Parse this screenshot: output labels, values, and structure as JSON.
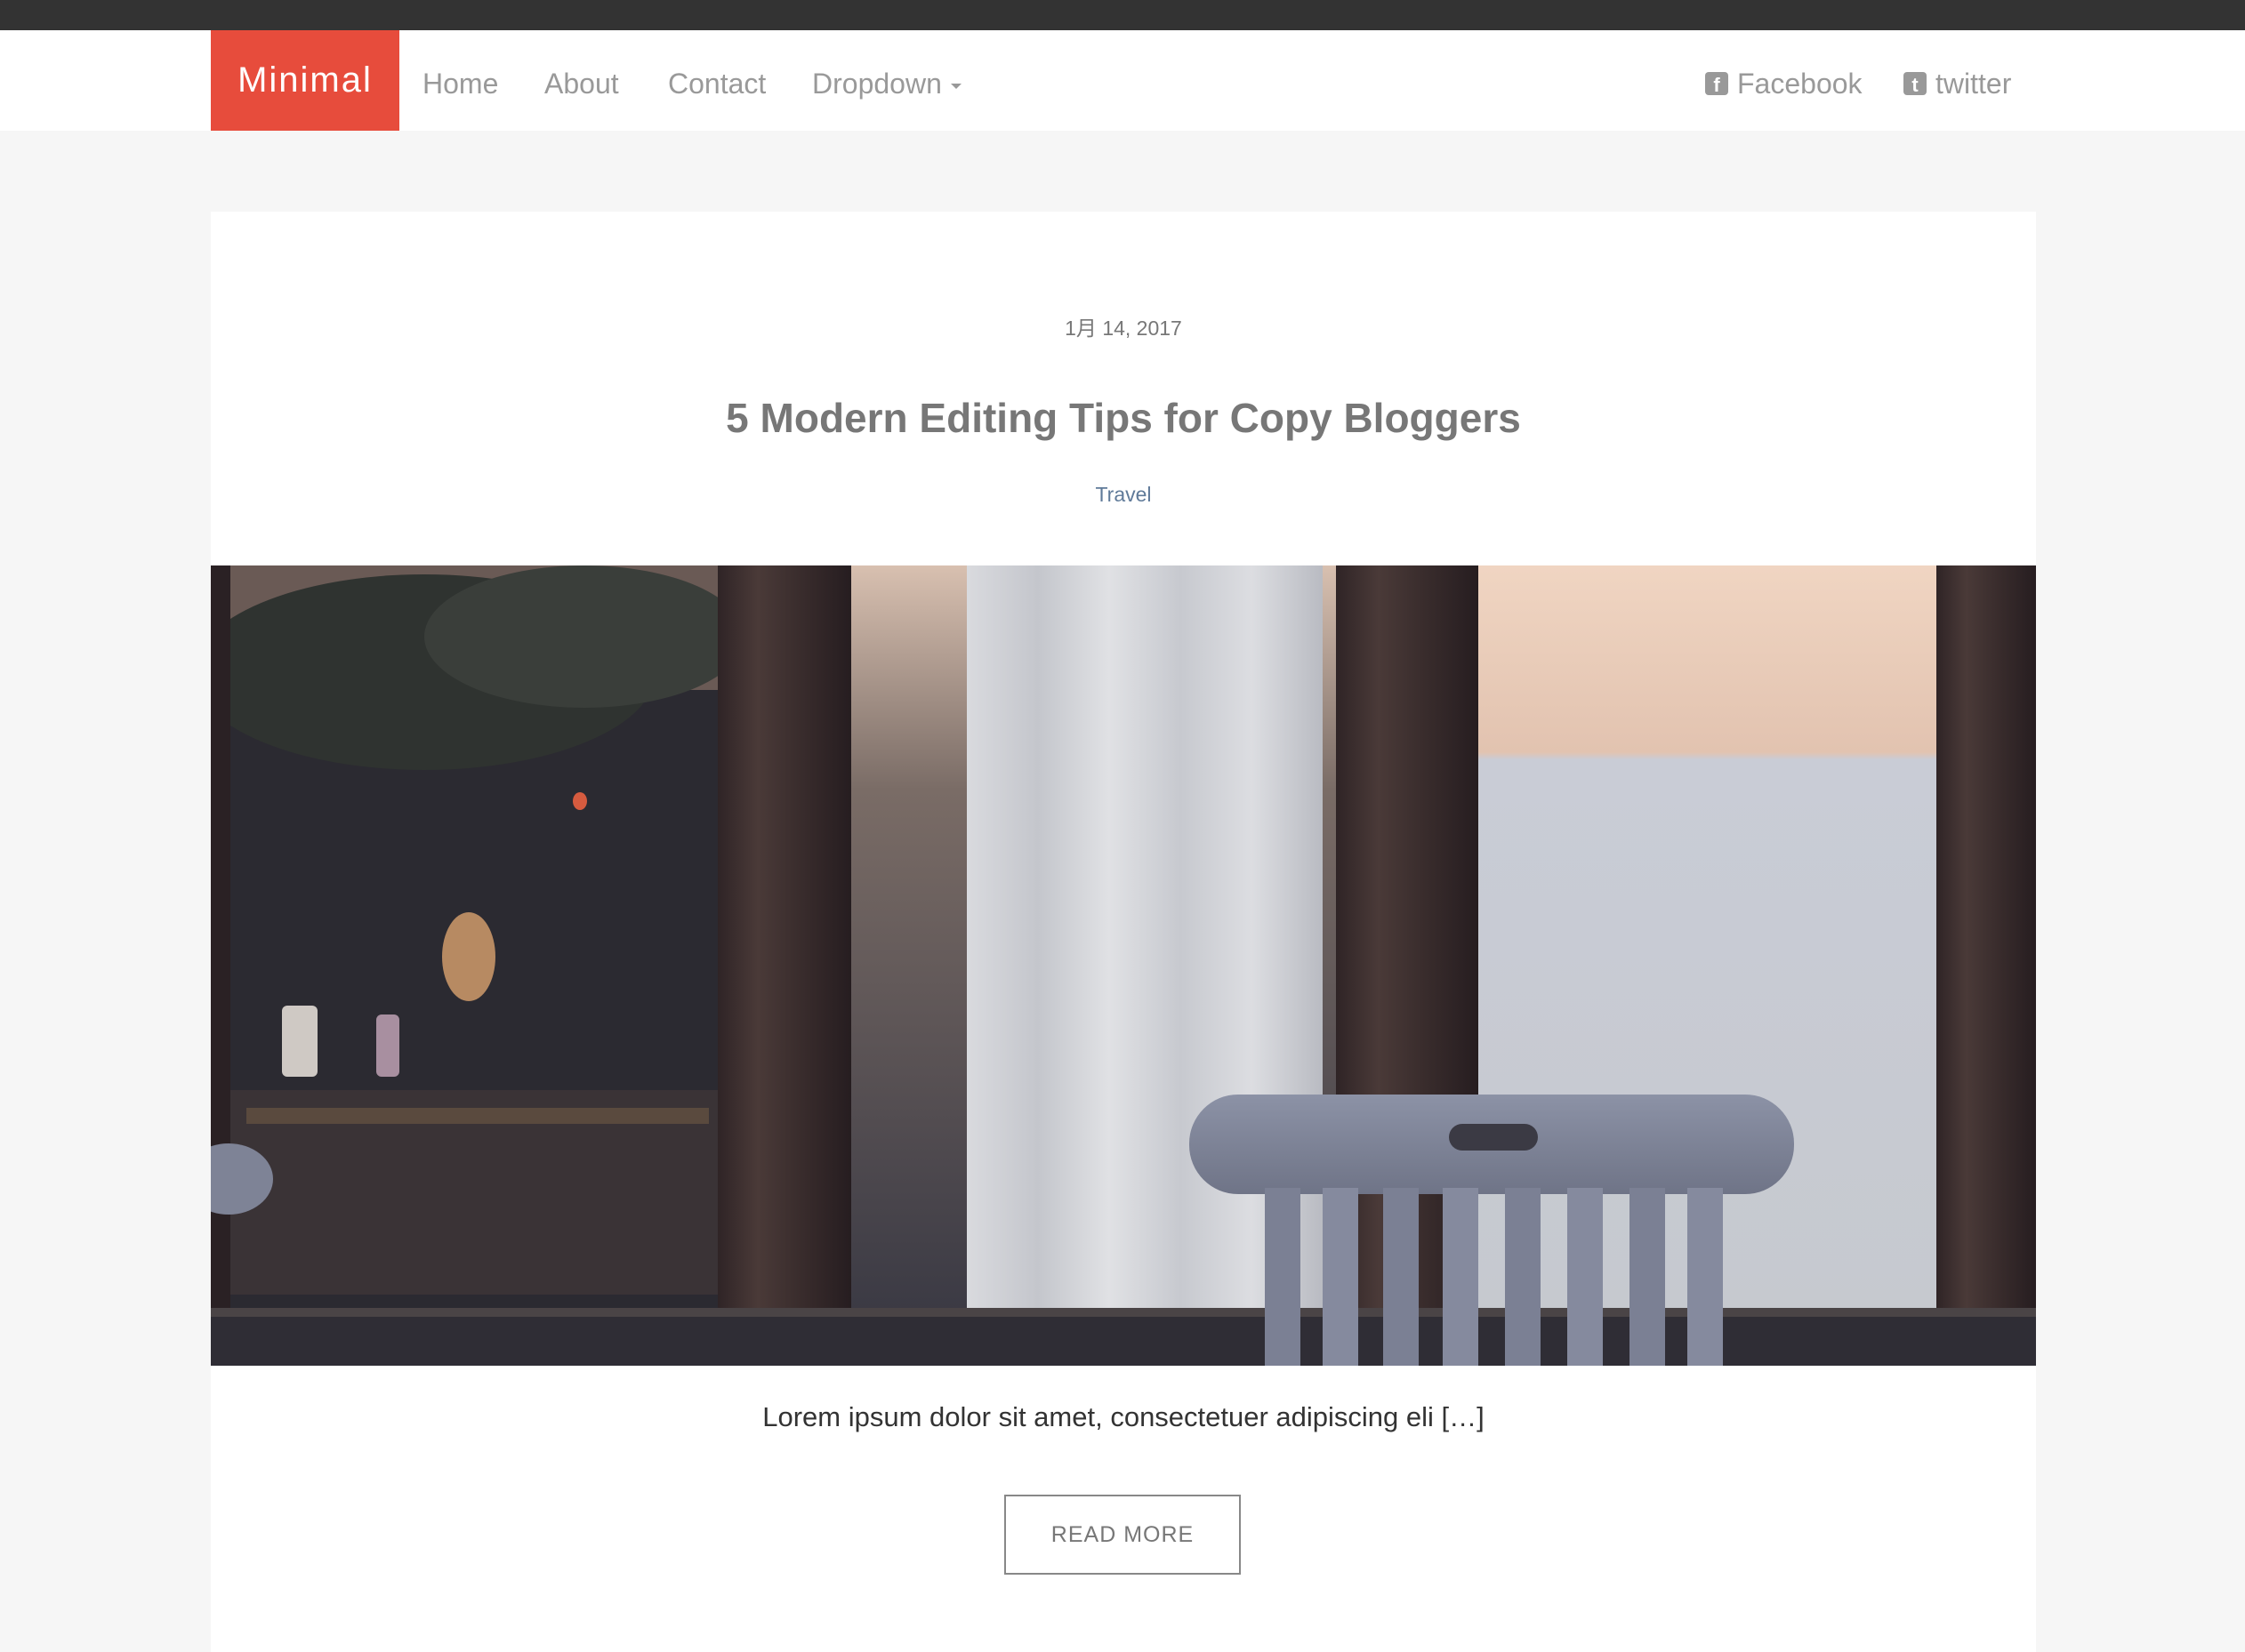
{
  "navbar": {
    "brand": "Minimal",
    "items": [
      {
        "label": "Home"
      },
      {
        "label": "About"
      },
      {
        "label": "Contact"
      },
      {
        "label": "Dropdown"
      }
    ],
    "social": [
      {
        "label": "Facebook",
        "icon": "facebook-icon"
      },
      {
        "label": "twitter",
        "icon": "twitter-icon"
      }
    ]
  },
  "post": {
    "date": "1月 14, 2017",
    "title": "5 Modern Editing Tips for Copy Bloggers",
    "category": "Travel",
    "image_description": "photo-window-chair",
    "excerpt": "Lorem ipsum dolor sit amet, consectetuer adipiscing eli […]",
    "read_more": "READ MORE"
  },
  "colors": {
    "brand": "#e74c3c",
    "topbar": "#333333",
    "page_background": "#f6f6f6",
    "nav_text": "#999999",
    "title_text": "#777777",
    "category_link": "#5f7a99"
  }
}
